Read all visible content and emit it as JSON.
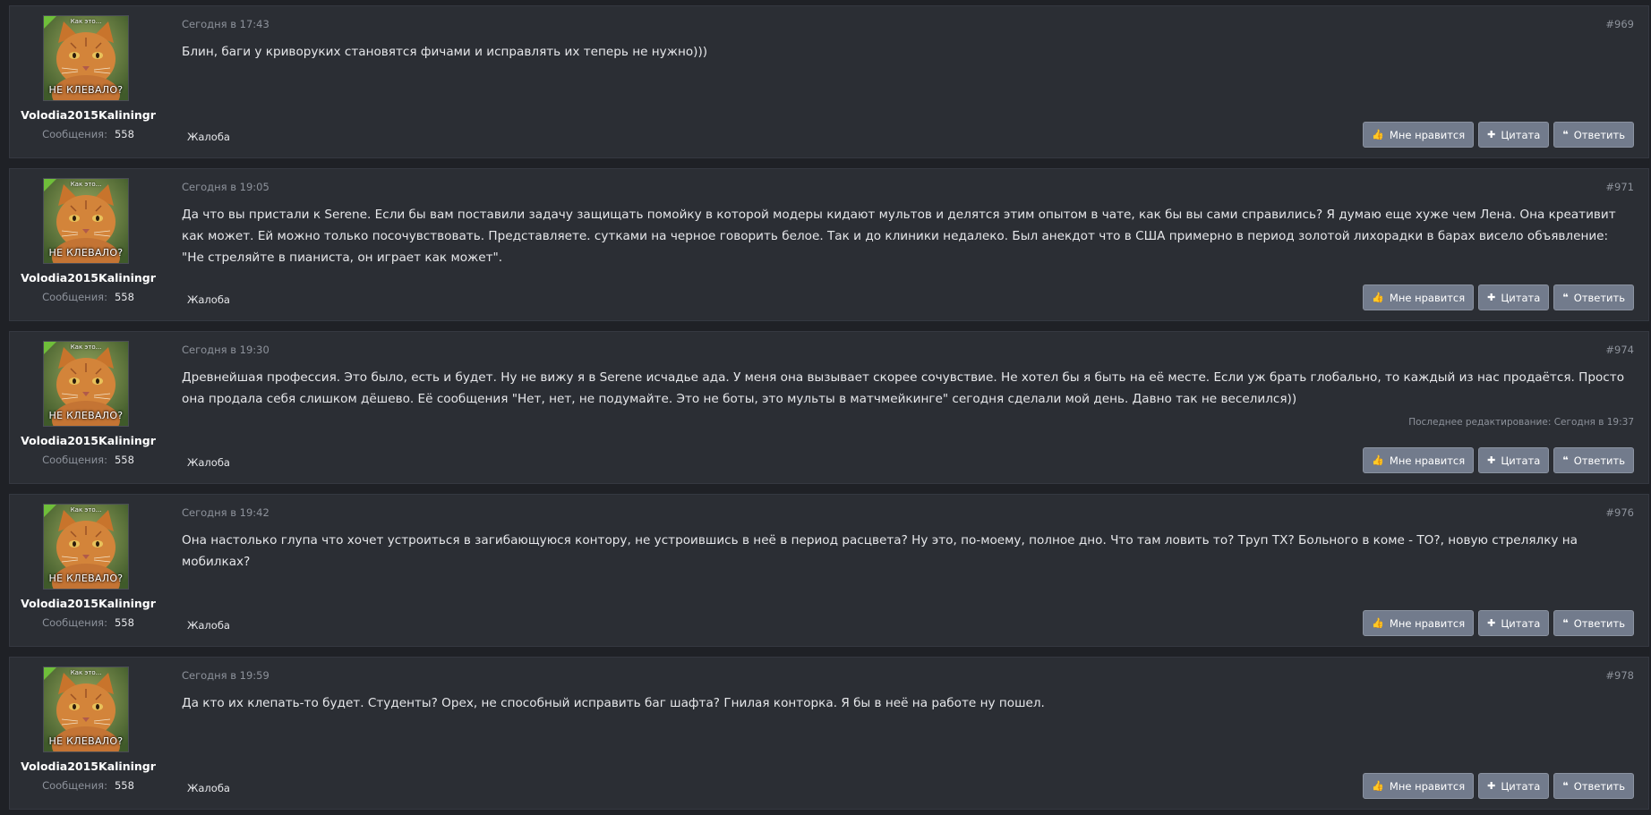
{
  "user": {
    "name": "Volodia2015Kaliningr",
    "messages_label": "Сообщения:",
    "messages_count": "558",
    "avatar_caption_top": "Как это...",
    "avatar_caption_bottom": "НЕ КЛЕВАЛО?"
  },
  "actions": {
    "report": "Жалоба",
    "like": "Мне нравится",
    "quote": "Цитата",
    "reply": "Ответить"
  },
  "icons": {
    "like": "thumbs-up-icon",
    "quote": "plus-icon",
    "reply": "quote-icon"
  },
  "posts": [
    {
      "date": "Сегодня в 17:43",
      "number": "#969",
      "text": "Блин, баги у криворуких становятся фичами и исправлять их теперь не нужно)))",
      "edited": ""
    },
    {
      "date": "Сегодня в 19:05",
      "number": "#971",
      "text": "Да что вы пристали к Serene. Если бы вам поставили задачу защищать помойку в которой модеры кидают мультов и делятся этим опытом в чате, как бы вы сами справились? Я думаю еще хуже чем Лена. Она креативит как может. Ей можно только посочувствовать. Представляете. сутками на черное говорить белое. Так и до клиники недалеко. Был анекдот что в США примерно в период золотой лихорадки в барах висело объявление: \"Не стреляйте в пианиста, он играет как может\".",
      "edited": ""
    },
    {
      "date": "Сегодня в 19:30",
      "number": "#974",
      "text": "Древнейшая профессия. Это было, есть и будет. Ну не вижу я в Serene исчадье ада. У меня она вызывает скорее сочувствие. Не хотел бы я быть на её месте. Если уж брать глобально, то каждый из нас продаётся. Просто она продала себя слишком дёшево. Её сообщения \"Нет, нет, не подумайте. Это не боты, это мульты в матчмейкинге\" сегодня сделали мой день. Давно так не веселился))",
      "edited": "Последнее редактирование: Сегодня в 19:37"
    },
    {
      "date": "Сегодня в 19:42",
      "number": "#976",
      "text": "Она настолько глупа что хочет устроиться в загибающуюся контору, не устроившись в неё в период расцвета? Ну это, по-моему, полное дно. Что там ловить то? Труп ТХ? Больного в коме - ТО?, новую стрелялку на мобилках?",
      "edited": ""
    },
    {
      "date": "Сегодня в 19:59",
      "number": "#978",
      "text": "Да кто их клепать-то будет. Студенты? Орех, не способный исправить баг шафта? Гнилая конторка. Я бы в неё на работе ну пошел.",
      "edited": ""
    }
  ]
}
